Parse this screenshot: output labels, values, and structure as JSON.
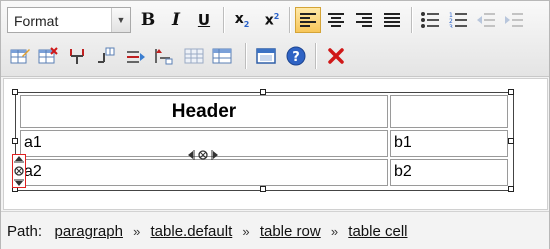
{
  "toolbar": {
    "format_select": {
      "value": "Format"
    },
    "buttons_row1": [
      {
        "name": "bold-icon",
        "label": "B"
      },
      {
        "name": "italic-icon",
        "label": "I"
      },
      {
        "name": "underline-icon",
        "label": "U"
      },
      {
        "name": "subscript-icon",
        "label": "x",
        "sub": "2"
      },
      {
        "name": "superscript-icon",
        "label": "x",
        "sup": "2"
      },
      {
        "name": "align-left-icon"
      },
      {
        "name": "align-center-icon"
      },
      {
        "name": "align-right-icon"
      },
      {
        "name": "justify-icon"
      },
      {
        "name": "bullet-list-icon"
      },
      {
        "name": "numbered-list-icon"
      },
      {
        "name": "outdent-icon"
      },
      {
        "name": "indent-icon"
      }
    ],
    "active_button": "align-left-icon"
  },
  "colors": {
    "active_button": "#f7c659",
    "row_marker_border": "#e02020",
    "delete_icon": "#d01818"
  },
  "table": {
    "header": "Header",
    "rows": [
      [
        "a1",
        "b1"
      ],
      [
        "a2",
        "b2"
      ]
    ]
  },
  "pathbar": {
    "label": "Path:",
    "separator": "»",
    "items": [
      "paragraph",
      "table.default",
      "table row",
      "table cell"
    ]
  }
}
